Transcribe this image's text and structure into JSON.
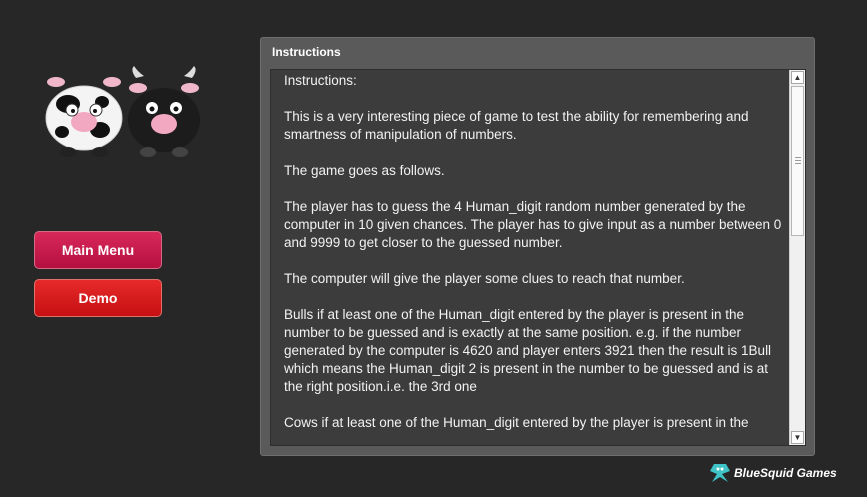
{
  "colors": {
    "background": "#272727",
    "panel": "#5a5a5a",
    "textbox": "#3c3c3c",
    "main_menu_button": "#c8184a",
    "demo_button": "#d91c1e"
  },
  "sidebar": {
    "logo_icon": "two-cows-icon",
    "main_menu_label": "Main Menu",
    "demo_label": "Demo"
  },
  "panel": {
    "title": "Instructions",
    "paragraphs": [
      "Instructions:",
      "This is a very interesting piece of game to test the ability for remembering and smartness of manipulation of numbers.",
      "The game goes as follows.",
      "The player has to guess the 4 Human_digit random number generated by the computer in 10 given chances. The player has to give input as a number between 0 and 9999 to get closer to the guessed number.",
      "The computer will give the player some clues to reach that number.",
      "Bulls if at least one of the Human_digit entered by the player is present in the number to be guessed and is exactly at the same position. e.g. if the number generated by the computer is 4620 and player enters 3921 then the result is 1Bull which means the Human_digit 2 is present in the number to be guessed and is at the right position.i.e. the 3rd one",
      "Cows if at least one of the Human_digit entered by the player is present in the"
    ]
  },
  "footer": {
    "brand_icon": "bluesquid-icon",
    "brand_name": "BlueSquid Games"
  }
}
